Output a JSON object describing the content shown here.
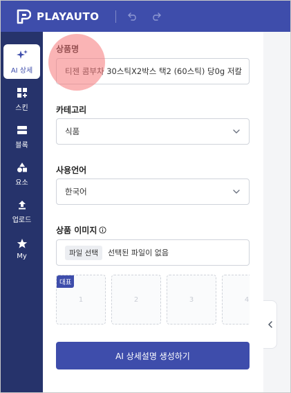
{
  "header": {
    "logo_text": "PLAYAUTO",
    "undo_icon": "undo-icon",
    "redo_icon": "redo-icon"
  },
  "sidebar": {
    "items": [
      {
        "label": "AI 상세",
        "icon": "sparkle-icon",
        "active": true
      },
      {
        "label": "스킨",
        "icon": "grid-icon"
      },
      {
        "label": "블록",
        "icon": "block-icon"
      },
      {
        "label": "요소",
        "icon": "shapes-icon"
      },
      {
        "label": "업로드",
        "icon": "upload-icon"
      },
      {
        "label": "My",
        "icon": "star-icon"
      }
    ]
  },
  "form": {
    "product_name_label": "상품명",
    "product_name_value": "티젠 콤부차 30스틱X2박스 택2 (60스틱) 당0g 저칼",
    "category_label": "카테고리",
    "category_value": "식품",
    "language_label": "사용언어",
    "language_value": "한국어",
    "image_label": "상품 이미지",
    "file_button": "파일 선택",
    "file_status": "선택된 파일이 없음",
    "thumbnails": [
      {
        "number": "1",
        "badge": "대표"
      },
      {
        "number": "2"
      },
      {
        "number": "3"
      },
      {
        "number": "4"
      }
    ],
    "generate_button": "AI 상세설명 생성하기"
  },
  "colors": {
    "accent": "#3e4dab",
    "sidebar": "#26336b",
    "highlight": "#f67678"
  }
}
